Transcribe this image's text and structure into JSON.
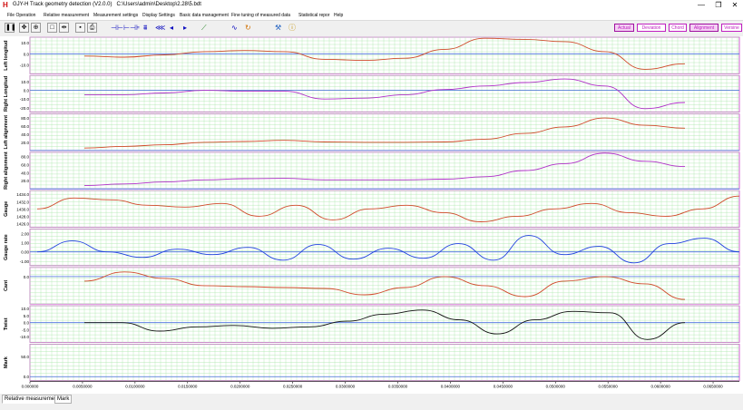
{
  "window": {
    "title": "GJY-H Track geometry detection (V2.0.0)",
    "path": "C:\\Users\\admin\\Desktop\\2.28\\5.bdt",
    "logo": "H",
    "minimize": "—",
    "maximize": "❐",
    "close": "✕"
  },
  "menu": [
    "File Operation",
    "Relative measurement",
    "Measurement settings",
    "Display Settings",
    "Basic data management",
    "Fine tuning of measured data",
    "Statistical repor",
    "Help"
  ],
  "view_buttons": [
    {
      "label": "Actual",
      "active": true
    },
    {
      "label": "Deviation",
      "active": false
    },
    {
      "label": "Chord",
      "active": false
    },
    {
      "label": "Alignment",
      "active": true
    },
    {
      "label": "Versine",
      "active": false
    }
  ],
  "colors": {
    "grid": "#a8e6a8",
    "zero_line": "#4a6ee0",
    "panel_border": "#c832c8",
    "series_red": "#d04a2a",
    "series_purple": "#b030c8",
    "series_blue": "#2040e0",
    "series_black": "#101010"
  },
  "chart_data": {
    "type": "line",
    "x_axis": {
      "ticks": [
        "0.000000",
        "0.0050000",
        "0.0100000",
        "0.0150000",
        "0.0200000",
        "0.0250000",
        "0.0300000",
        "0.0350000",
        "0.0400000",
        "0.0450000",
        "0.0500000",
        "0.0550000",
        "0.0600000",
        "0.0650000"
      ],
      "range": [
        0,
        0.0675
      ]
    },
    "panels": [
      {
        "label": "Left longitud",
        "color_key": "series_red",
        "yticks": [
          "10.0",
          "0.0",
          "-10.0"
        ],
        "ylim": [
          -18,
          15
        ],
        "zero": 0,
        "y": [
          -2,
          -3,
          -1,
          2,
          3,
          2,
          -5,
          -6,
          -4,
          4,
          14,
          13,
          11,
          2,
          -14,
          -9
        ]
      },
      {
        "label": "Right Longitud",
        "color_key": "series_purple",
        "yticks": [
          "10.0",
          "0.0",
          "-10.0",
          "-20.0"
        ],
        "ylim": [
          -25,
          17
        ],
        "zero": 0,
        "y": [
          -5,
          -5,
          -3,
          0,
          -1,
          -1,
          -10,
          -9,
          -5,
          1,
          5,
          9,
          13,
          5,
          -21,
          -14
        ]
      },
      {
        "label": "Left alignment",
        "color_key": "series_red",
        "yticks": [
          "80.0",
          "60.0",
          "40.0",
          "20.0"
        ],
        "ylim": [
          0,
          90
        ],
        "zero": 0,
        "y": [
          6,
          10,
          14,
          20,
          22,
          25,
          21,
          20,
          20,
          21,
          28,
          42,
          58,
          80,
          62,
          55
        ]
      },
      {
        "label": "Right alignment",
        "color_key": "series_purple",
        "yticks": [
          "80.0",
          "60.0",
          "40.0",
          "20.0"
        ],
        "ylim": [
          0,
          90
        ],
        "zero": 0,
        "y": [
          8,
          12,
          17,
          22,
          25,
          26,
          22,
          22,
          22,
          24,
          30,
          45,
          62,
          88,
          68,
          55
        ]
      },
      {
        "label": "Gauge",
        "color_key": "series_red",
        "yticks": [
          "1434.0",
          "1432.0",
          "1430.0",
          "1428.0",
          "1426.0"
        ],
        "ylim": [
          1425,
          1435
        ],
        "zero": null,
        "y": [
          1430,
          1433,
          1432.5,
          1431,
          1430.5,
          1431.5,
          1428,
          1431,
          1427,
          1430,
          1431,
          1429,
          1426.5,
          1428,
          1430,
          1431.5,
          1429,
          1428,
          1430,
          1433.5
        ]
      },
      {
        "label": "Gauge rate",
        "color_key": "series_blue",
        "yticks": [
          "2.00",
          "1.00",
          "0.00",
          "-1.00"
        ],
        "ylim": [
          -1.5,
          2.5
        ],
        "zero": 0,
        "y": [
          0,
          1.2,
          0,
          -0.6,
          0.3,
          -0.3,
          0.5,
          -0.9,
          0.8,
          -0.8,
          0.4,
          -0.7,
          0.9,
          -0.9,
          1.8,
          -0.3,
          0.6,
          -1.2,
          0.9,
          1.5,
          0
        ]
      },
      {
        "label": "Cant",
        "color_key": "series_red",
        "yticks": [
          "0.0"
        ],
        "ylim": [
          -30,
          10
        ],
        "zero": 0,
        "y": [
          -5,
          5,
          -2,
          -10,
          -11,
          -12,
          -13,
          -20,
          -12,
          0,
          -10,
          -22,
          -5,
          0,
          -8,
          -25
        ]
      },
      {
        "label": "Twist",
        "color_key": "series_black",
        "yticks": [
          "10.0",
          "5.0",
          "0.0",
          "-5.0",
          "-10.0"
        ],
        "ylim": [
          -14,
          12
        ],
        "zero": 0,
        "y": [
          0,
          0,
          -6,
          -3,
          -2,
          -4,
          -3,
          1,
          6,
          9,
          2,
          -8,
          2,
          8,
          7,
          -12,
          0
        ]
      },
      {
        "label": "Mark",
        "color_key": "series_black",
        "yticks": [
          "50.0",
          "0.0"
        ],
        "ylim": [
          -10,
          80
        ],
        "zero": 0,
        "y": []
      }
    ]
  },
  "tabs": [
    {
      "label": "Relative measurement",
      "selected": true
    },
    {
      "label": "Mark",
      "selected": false
    }
  ]
}
